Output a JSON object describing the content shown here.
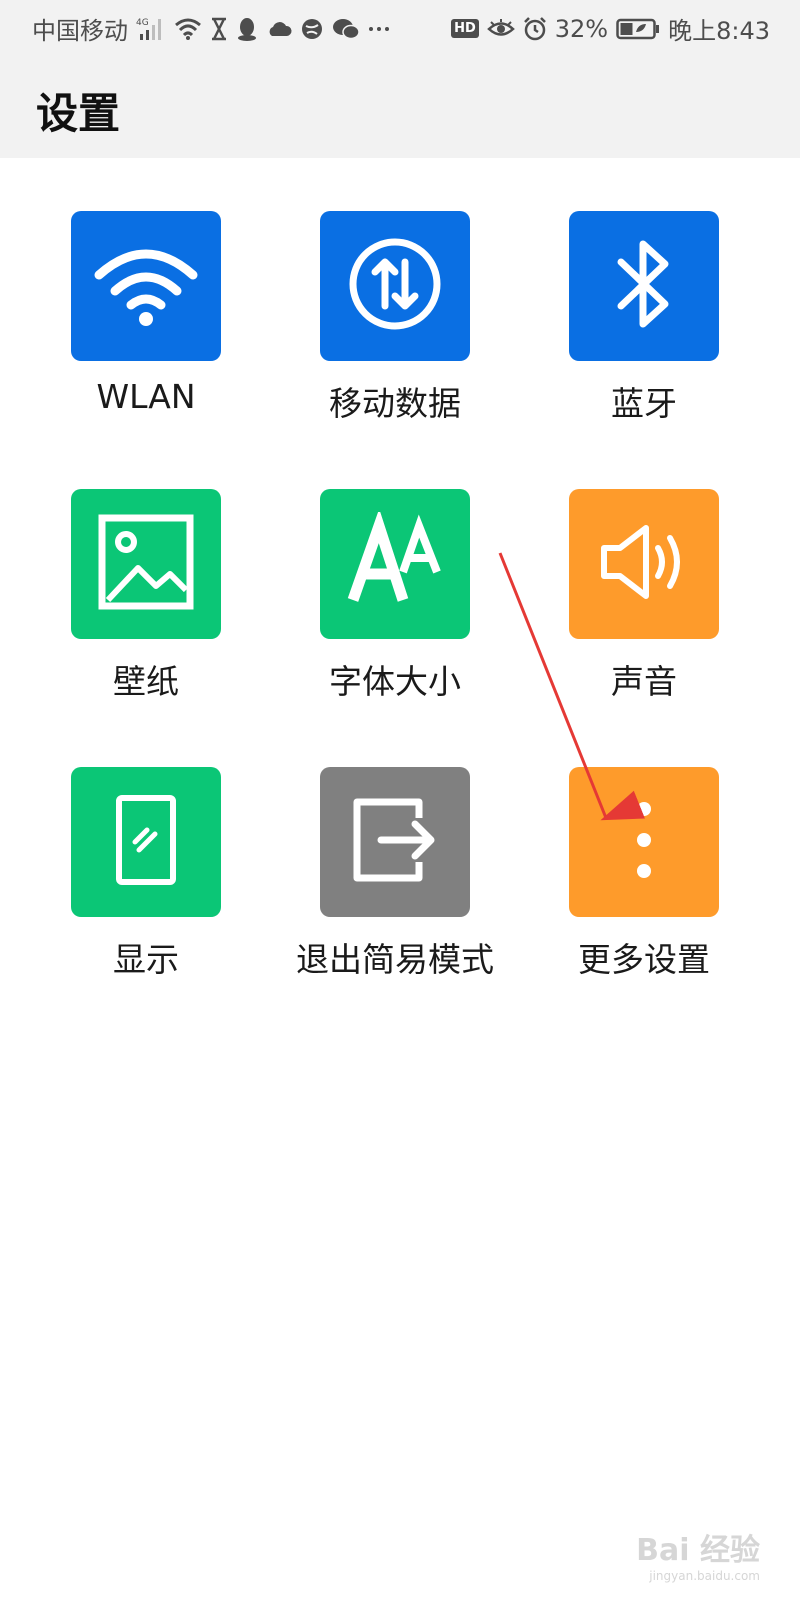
{
  "status_bar": {
    "carrier": "中国移动",
    "network": "4G",
    "battery_percent": "32%",
    "time": "晚上8:43",
    "hd_label": "HD",
    "left_icons": [
      "signal-icon",
      "wifi-icon",
      "hourglass-icon",
      "qq-icon",
      "cloud-icon",
      "browser-icon",
      "wechat-icon",
      "more-notifications-icon"
    ],
    "right_icons": [
      "hd-icon",
      "eye-icon",
      "alarm-icon",
      "battery-icon"
    ]
  },
  "header": {
    "title": "设置"
  },
  "tiles": [
    {
      "label": "WLAN",
      "icon": "wifi-icon",
      "color": "#0a6fe3"
    },
    {
      "label": "移动数据",
      "icon": "mobile-data-icon",
      "color": "#0a6fe3"
    },
    {
      "label": "蓝牙",
      "icon": "bluetooth-icon",
      "color": "#0a6fe3"
    },
    {
      "label": "壁纸",
      "icon": "wallpaper-icon",
      "color": "#0bc676"
    },
    {
      "label": "字体大小",
      "icon": "font-size-icon",
      "color": "#0bc676"
    },
    {
      "label": "声音",
      "icon": "sound-icon",
      "color": "#fe9b2b"
    },
    {
      "label": "显示",
      "icon": "display-icon",
      "color": "#0bc676"
    },
    {
      "label": "退出简易模式",
      "icon": "exit-icon",
      "color": "#808080"
    },
    {
      "label": "更多设置",
      "icon": "more-icon",
      "color": "#fe9b2b"
    }
  ],
  "annotation": {
    "color": "#e53935"
  },
  "watermark": {
    "text": "Bai 经验",
    "subtext": "jingyan.baidu.com"
  }
}
